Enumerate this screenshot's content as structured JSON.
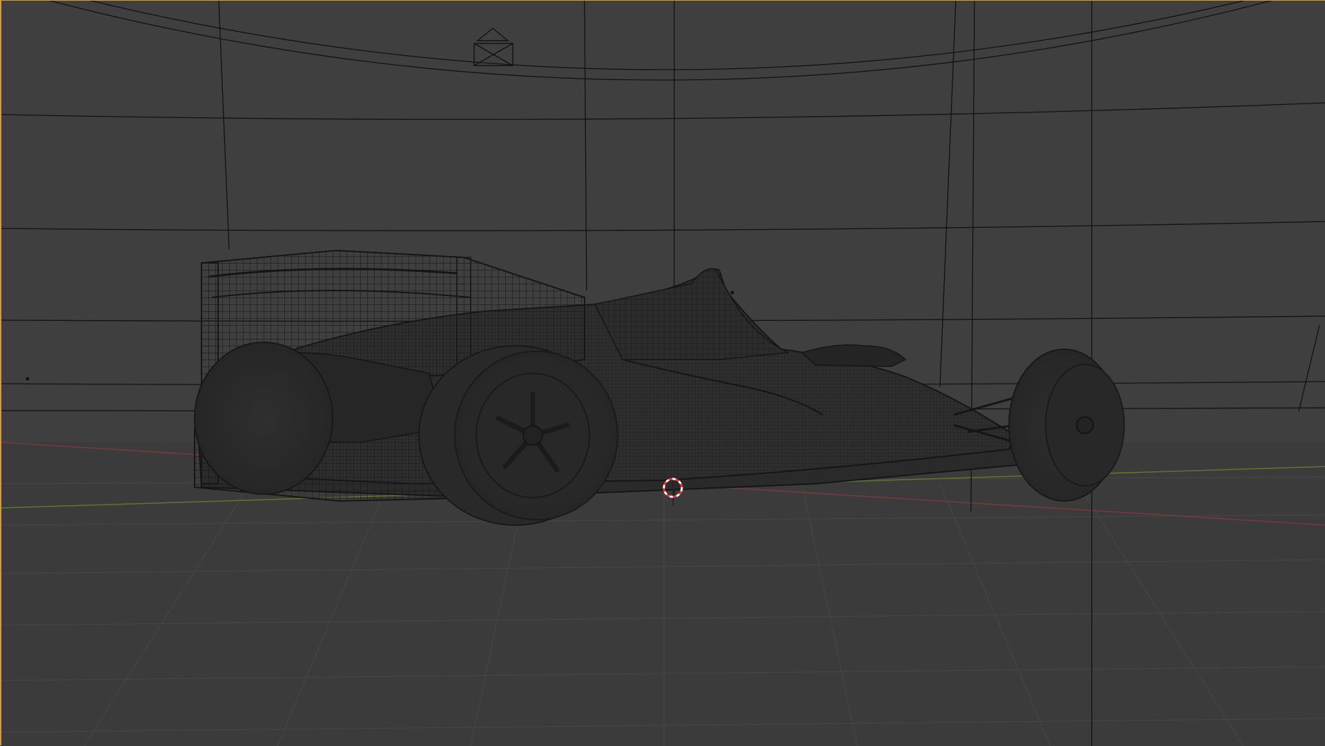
{
  "viewport": {
    "active_outline_color": "#d59b3a",
    "background_color": "#3d3d3d",
    "floor_grid_color": "#454545",
    "x_axis_color": "#7a3a3a",
    "y_axis_color": "#5a7a2a",
    "wire_color": "#111111",
    "model_color": "#2b2b2b",
    "cursor_colors": [
      "#ff3030",
      "#ffffff"
    ]
  },
  "objects": {
    "camera": {
      "icon": "camera-icon"
    },
    "cursor": {
      "icon": "3d-cursor-icon"
    },
    "model": {
      "icon": "formula-car-mesh"
    }
  }
}
